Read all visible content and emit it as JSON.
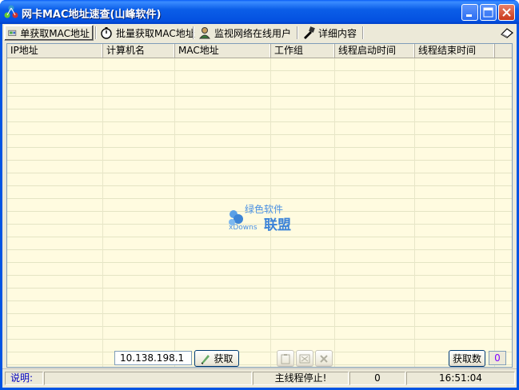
{
  "window": {
    "title": "网卡MAC地址速查(山峰软件)",
    "controls": {
      "minimize": "minimize-icon",
      "maximize": "maximize-icon",
      "close": "close-icon"
    }
  },
  "tabs": [
    {
      "label": "单获取MAC地址",
      "icon": "network-card-icon",
      "active": true
    },
    {
      "label": "批量获取MAC地址",
      "icon": "stopwatch-icon",
      "active": false
    },
    {
      "label": "监视网络在线用户",
      "icon": "user-monitor-icon",
      "active": false
    },
    {
      "label": "详细内容",
      "icon": "details-icon",
      "active": false
    }
  ],
  "table": {
    "columns": [
      "IP地址",
      "计算机名",
      "MAC地址",
      "工作组",
      "线程启动时间",
      "线程结束时间"
    ],
    "rows": []
  },
  "watermark": {
    "line1": "绿色软件",
    "line2": "xDowns",
    "line3": "联盟"
  },
  "controls": {
    "ip_value": "10.138.198.1",
    "fetch_label": "获取",
    "fetch_count_label": "获取数",
    "fetch_count_value": "0"
  },
  "statusbar": {
    "note_label": "说明:",
    "thread_status": "主线程停止!",
    "count": "0",
    "time": "16:51:04"
  },
  "colors": {
    "title_bar": "#0054e3",
    "grid_background": "#fffbe0",
    "purple_value": "#8000ff",
    "status_label": "#0000c0"
  }
}
